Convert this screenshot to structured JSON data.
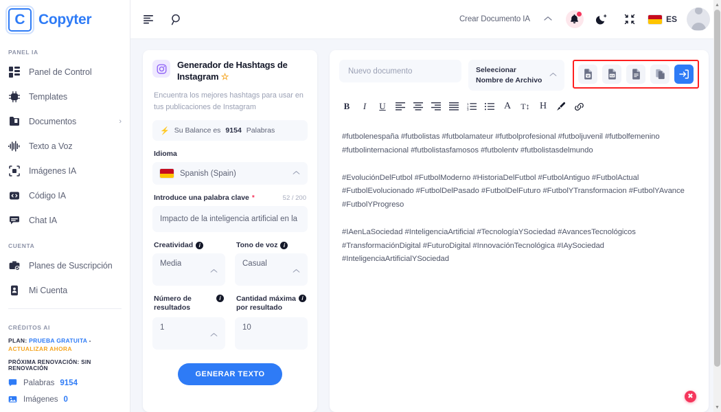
{
  "brand": {
    "logo_letter": "C",
    "name": "Copyter"
  },
  "sidebar": {
    "section_panel_title": "PANEL IA",
    "nav": [
      {
        "label": "Panel de Control",
        "icon": "dashboard-icon"
      },
      {
        "label": "Templates",
        "icon": "chip-ai-icon"
      },
      {
        "label": "Documentos",
        "icon": "documents-icon",
        "caret": "›"
      },
      {
        "label": "Texto a Voz",
        "icon": "waveform-icon"
      },
      {
        "label": "Imágenes IA",
        "icon": "image-frame-icon"
      },
      {
        "label": "Código IA",
        "icon": "code-icon"
      },
      {
        "label": "Chat IA",
        "icon": "chat-icon"
      }
    ],
    "section_account_title": "CUENTA",
    "account": [
      {
        "label": "Planes de Suscripción",
        "icon": "briefcase-check-icon"
      },
      {
        "label": "Mi Cuenta",
        "icon": "id-card-icon"
      }
    ],
    "section_credits_title": "CRÉDITOS AI",
    "plan_prefix": "PLAN:",
    "plan_value": "PRUEBA GRATUITA",
    "plan_dash": "-",
    "plan_upgrade": "ACTUALIZAR AHORA",
    "renewal": "PRÓXIMA RENOVACIÓN: SIN RENOVACIÓN",
    "credits": [
      {
        "label": "Palabras",
        "value": "9154",
        "icon": "chat-bubble-icon"
      },
      {
        "label": "Imágenes",
        "value": "0",
        "icon": "picture-icon"
      }
    ]
  },
  "topbar": {
    "menu_icon": "menu-align-icon",
    "search_icon": "search-icon",
    "create_doc_label": "Crear Documento IA",
    "caret": "⌃",
    "bell_icon": "bell-icon",
    "theme_icon": "moon-icon",
    "fullscreen_icon": "collapse-icon",
    "lang_code": "ES",
    "flag": "spain-flag-icon",
    "avatar": "user-avatar"
  },
  "generator": {
    "icon": "instagram-icon",
    "title": "Generador de Hashtags de Instagram",
    "star": "☆",
    "subtitle": "Encuentra los mejores hashtags para usar en tus publicaciones de Instagram",
    "balance_prefix": "Su Balance es",
    "balance_value": "9154",
    "balance_suffix": "Palabras",
    "idioma_label": "Idioma",
    "idioma_value": "Spanish (Spain)",
    "keyword_label": "Introduce una palabra clave",
    "keyword_required": "*",
    "keyword_counter": "52 / 200",
    "keyword_value": "Impacto de la inteligencia artificial en la",
    "creatividad_label": "Creatividad",
    "creatividad_value": "Media",
    "tono_label": "Tono de voz",
    "tono_value": "Casual",
    "numero_label": "Número de resultados",
    "numero_value": "1",
    "cantidad_label": "Cantidad máxima por resultado",
    "cantidad_value": "10",
    "generate_button": "GENERAR TEXTO"
  },
  "editor": {
    "doc_name_placeholder": "Nuevo documento",
    "file_select_label": "Seleecionar Nombre de Archivo",
    "actions": [
      {
        "name": "export-word-button",
        "icon": "word-file-icon",
        "glyph": "W"
      },
      {
        "name": "export-pdf-button",
        "icon": "pdf-file-icon",
        "glyph": "PDF"
      },
      {
        "name": "export-text-button",
        "icon": "text-file-icon",
        "glyph": ""
      },
      {
        "name": "copy-button",
        "icon": "copy-icon",
        "glyph": ""
      },
      {
        "name": "save-button",
        "icon": "save-document-icon",
        "glyph": ""
      }
    ],
    "format_tools": [
      {
        "name": "bold-icon",
        "glyph": "B"
      },
      {
        "name": "italic-icon",
        "glyph": "I"
      },
      {
        "name": "underline-icon",
        "glyph": "U"
      },
      {
        "name": "align-left-icon",
        "glyph": ""
      },
      {
        "name": "align-center-icon",
        "glyph": ""
      },
      {
        "name": "align-right-icon",
        "glyph": ""
      },
      {
        "name": "align-justify-icon",
        "glyph": ""
      },
      {
        "name": "ordered-list-icon",
        "glyph": ""
      },
      {
        "name": "bullet-list-icon",
        "glyph": ""
      },
      {
        "name": "font-color-icon",
        "glyph": "A"
      },
      {
        "name": "font-size-icon",
        "glyph": "T↕"
      },
      {
        "name": "heading-icon",
        "glyph": "H"
      },
      {
        "name": "highlight-brush-icon",
        "glyph": ""
      },
      {
        "name": "link-icon",
        "glyph": ""
      }
    ],
    "paragraphs": [
      "#futbolenespaña #futbolistas #futbolamateur #futbolprofesional #futboljuvenil #futbolfemenino #futbolinternacional #futbolistasfamosos #futbolentv #futbolistasdelmundo",
      "#EvoluciónDelFutbol #FutbolModerno #HistoriaDelFutbol #FutbolAntiguo #FutbolActual #FutbolEvolucionado #FutbolDelPasado #FutbolDelFuturo #FutbolYTransformacion #FutbolYAvance #FutbolYProgreso",
      "#IAenLaSociedad #InteligenciaArtificial #TecnologíaYSociedad #AvancesTecnológicos #TransformaciónDigital #FuturoDigital #InnovaciónTecnológica #IAySociedad #InteligenciaArtificialYSociedad"
    ],
    "close_glyph": "✖"
  },
  "colors": {
    "brand_blue": "#2e7bf6",
    "accent_orange": "#f5a623",
    "danger_red": "#f5365c",
    "highlight_box": "#ff1f1f",
    "page_bg": "#f4f6fb"
  }
}
